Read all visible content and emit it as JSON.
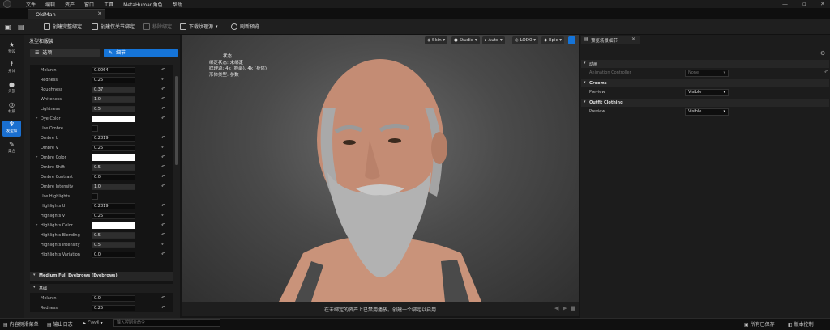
{
  "menubar": {
    "items": [
      "文件",
      "编辑",
      "资产",
      "窗口",
      "工具",
      "MetaHuman角色",
      "帮助"
    ]
  },
  "document_tab": {
    "title": "OldMan"
  },
  "toolbar": {
    "buttons": [
      "创建完整绑定",
      "创建仅关节绑定",
      "移除绑定",
      "下载纹理源",
      "刷新预览"
    ]
  },
  "left_strip": {
    "items": [
      "预设",
      "身体",
      "头部",
      "材质",
      "发型和",
      "集合"
    ],
    "active_index": 4
  },
  "panel": {
    "title": "发型和服装",
    "tabs": {
      "presets": "选项",
      "details": "细节"
    }
  },
  "properties": [
    {
      "label": "Melanin",
      "kind": "value",
      "value": "0.0064"
    },
    {
      "label": "Redness",
      "kind": "value",
      "value": "0.25"
    },
    {
      "label": "Roughness",
      "kind": "slider",
      "value": "0.37"
    },
    {
      "label": "Whiteness",
      "kind": "slider",
      "value": "1.0"
    },
    {
      "label": "Lightness",
      "kind": "slider",
      "value": "0.5"
    },
    {
      "label": "Dye Color",
      "kind": "color",
      "value": ""
    },
    {
      "label": "Use Ombre",
      "kind": "check",
      "value": ""
    },
    {
      "label": "Ombre U",
      "kind": "value",
      "value": "0.2819"
    },
    {
      "label": "Ombre V",
      "kind": "value",
      "value": "0.25"
    },
    {
      "label": "Ombre Color",
      "kind": "color",
      "value": ""
    },
    {
      "label": "Ombre Shift",
      "kind": "slider",
      "value": "0.5"
    },
    {
      "label": "Ombre Contrast",
      "kind": "value",
      "value": "0.0"
    },
    {
      "label": "Ombre Intensity",
      "kind": "slider",
      "value": "1.0"
    },
    {
      "label": "Use Highlights",
      "kind": "check",
      "value": ""
    },
    {
      "label": "Highlights U",
      "kind": "value",
      "value": "0.2819"
    },
    {
      "label": "Highlights V",
      "kind": "value",
      "value": "0.25"
    },
    {
      "label": "Highlights Color",
      "kind": "color",
      "value": ""
    },
    {
      "label": "Highlights Blending",
      "kind": "slider",
      "value": "0.5"
    },
    {
      "label": "Highlights Intensity",
      "kind": "slider",
      "value": "0.5"
    },
    {
      "label": "Highlights Variation",
      "kind": "value",
      "value": "0.0"
    }
  ],
  "section_eyebrows": {
    "title": "Medium Full Eyebrows (Eyebrows)",
    "sub": "基础"
  },
  "eyebrow_properties": [
    {
      "label": "Melanin",
      "value": "0.0"
    },
    {
      "label": "Redness",
      "value": "0.25"
    }
  ],
  "viewport": {
    "buttons": [
      "Skin",
      "Studio",
      "Auto",
      "LOD0",
      "Epic"
    ],
    "status_title": "状态",
    "status_lines": [
      "绑定状态: 未绑定",
      "纹理源: 4k (脸部), 4k (身体)",
      "形体类型: 参数"
    ],
    "bottom_message": "在未绑定的资产上已禁用播放。创建一个绑定以启用"
  },
  "right_panel": {
    "tab": "预览场景细节",
    "sections": [
      {
        "title": "动画",
        "rows": [
          {
            "label": "Animation Controller",
            "value": "None",
            "disabled": true
          }
        ]
      },
      {
        "title": "Grooms",
        "rows": [
          {
            "label": "Preview",
            "value": "Visible",
            "disabled": false
          }
        ]
      },
      {
        "title": "Outfit Clothing",
        "rows": [
          {
            "label": "Preview",
            "value": "Visible",
            "disabled": false
          }
        ]
      }
    ]
  },
  "statusbar": {
    "content_drawer": "内容侧滑菜单",
    "output_log": "输出日志",
    "cmd": "Cmd",
    "cmd_placeholder": "输入控制台命令",
    "all_saved": "所有已保存",
    "version_control": "版本控制"
  },
  "colors": {
    "accent": "#1574d8",
    "bg": "#151515",
    "panel": "#1e1e1e"
  }
}
